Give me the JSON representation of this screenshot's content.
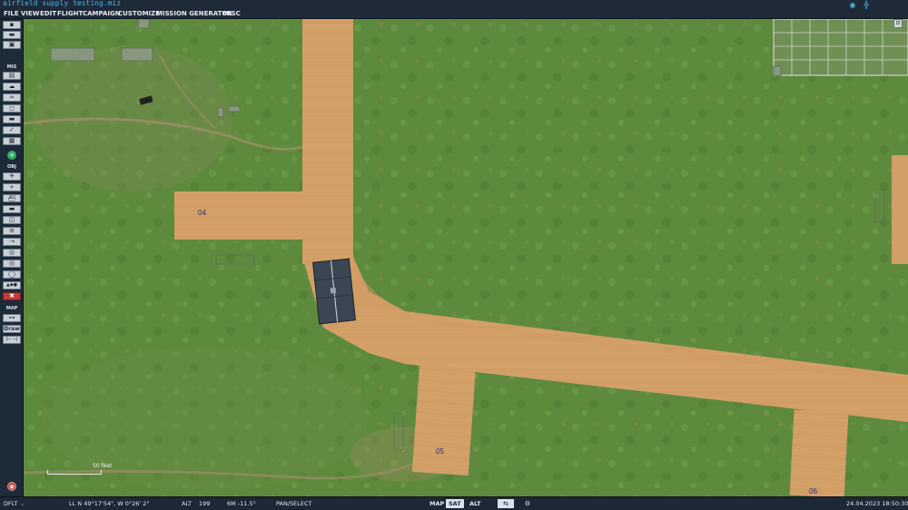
{
  "window": {
    "title": "airfield supply testing.miz"
  },
  "titlebar_icons": [
    {
      "name": "wifi-icon",
      "glyph": "◉"
    },
    {
      "name": "antenna-icon",
      "glyph": "╬"
    }
  ],
  "menu": [
    "FILE",
    "VIEW",
    "EDIT",
    "FLIGHT",
    "CAMPAIGN",
    "CUSTOMIZE",
    "MISSION GENERATOR",
    "MISC"
  ],
  "toolbar": {
    "section_mis": "MIS",
    "section_obj": "OBJ",
    "section_map": "MAP",
    "draw_label": "Draw",
    "file_buttons": [
      {
        "name": "new-file-icon",
        "glyph": "▪"
      },
      {
        "name": "open-folder-icon",
        "glyph": "▬"
      },
      {
        "name": "save-icon",
        "glyph": "▣"
      }
    ],
    "mis_buttons": [
      {
        "name": "briefing-icon",
        "glyph": "▤"
      },
      {
        "name": "weather-icon",
        "glyph": "☁"
      },
      {
        "name": "triggers-icon",
        "glyph": "≈"
      },
      {
        "name": "goals-icon",
        "glyph": "◻"
      },
      {
        "name": "resources-icon",
        "glyph": "▬"
      },
      {
        "name": "check-icon",
        "glyph": "✓"
      },
      {
        "name": "overview-icon",
        "glyph": "▦"
      }
    ],
    "obj_buttons": [
      {
        "name": "aircraft-icon",
        "glyph": "✈"
      },
      {
        "name": "helicopter-icon",
        "glyph": "⌖"
      },
      {
        "name": "ship-icon",
        "glyph": "⛴"
      },
      {
        "name": "vehicle-icon",
        "glyph": "▬"
      },
      {
        "name": "static-object-icon",
        "glyph": "◫"
      },
      {
        "name": "train-icon",
        "glyph": "≡"
      },
      {
        "name": "route-icon",
        "glyph": "⇢"
      },
      {
        "name": "zone-icon",
        "glyph": "◎"
      },
      {
        "name": "target-icon",
        "glyph": "◎"
      },
      {
        "name": "circle-zone-icon",
        "glyph": "◯"
      },
      {
        "name": "shapes-icon",
        "glyph": "▲◆●"
      },
      {
        "name": "delete-icon",
        "glyph": "✖"
      }
    ],
    "map_buttons": [
      {
        "name": "measure-icon",
        "glyph": "⊶"
      },
      {
        "name": "ruler-icon",
        "glyph": "⊢⊣"
      }
    ]
  },
  "map": {
    "taxiway_labels": [
      "04",
      "05",
      "06"
    ],
    "scale_label": "50 feet"
  },
  "status": {
    "profile": "DFLT",
    "coords": "LL  N 49°17'54\",  W  0°26' 2\"",
    "alt_label": "ALT",
    "alt_value": "199",
    "mag": "6M  -11.5°",
    "mode": "PAN/SELECT",
    "map_modes": [
      "MAP",
      "SAT",
      "ALT"
    ],
    "active_map_mode": "SAT",
    "datetime": "24.04.2023 18:50:30"
  },
  "colors": {
    "accent": "#4fb3e8",
    "grass": "#5f8b3f",
    "dirt": "#d4a067"
  }
}
